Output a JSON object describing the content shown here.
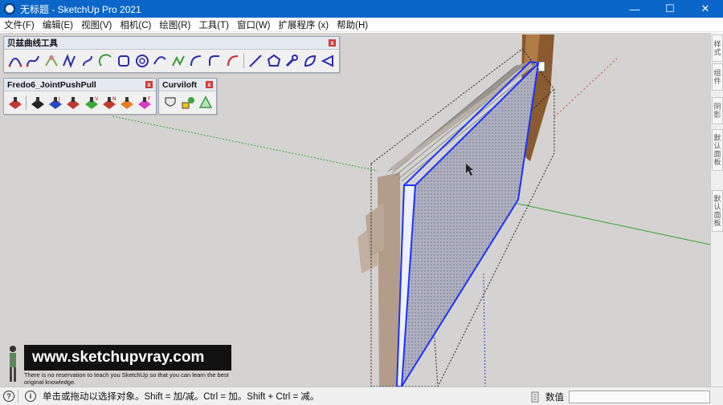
{
  "window": {
    "title": "无标题 - SketchUp Pro 2021",
    "minimize": "—",
    "maximize": "☐",
    "close": "✕"
  },
  "menu": [
    "文件(F)",
    "编辑(E)",
    "视图(V)",
    "相机(C)",
    "绘图(R)",
    "工具(T)",
    "窗口(W)",
    "扩展程序 (x)",
    "帮助(H)"
  ],
  "toolbars": {
    "bezier": {
      "title": "贝兹曲线工具",
      "close": "x"
    },
    "fredo": {
      "title": "Fredo6_JointPushPull",
      "close": "x",
      "letters": [
        "",
        "",
        "J",
        "",
        "V",
        "N",
        "",
        "F"
      ]
    },
    "curviloft": {
      "title": "Curviloft",
      "close": "x"
    }
  },
  "tray_tabs": [
    "样式",
    "组件",
    "阴影",
    "默认面板",
    "默认面板"
  ],
  "watermark": {
    "url": "www.sketchupvray.com",
    "tagline": "There is no reservation to teach you SketchUp so that you can learn the best original knowledge."
  },
  "status": {
    "hint": "单击或拖动以选择对象。Shift = 加/减。Ctrl = 加。Shift + Ctrl = 减。",
    "value_label": "数值",
    "value": ""
  },
  "colors": {
    "titlebar": "#0a66c8",
    "viewport_bg": "#d4d3d1",
    "selection_blue": "#1a33ff",
    "axis_green": "#2ea82e",
    "axis_red": "#c44",
    "wood": "#8a5a30"
  }
}
